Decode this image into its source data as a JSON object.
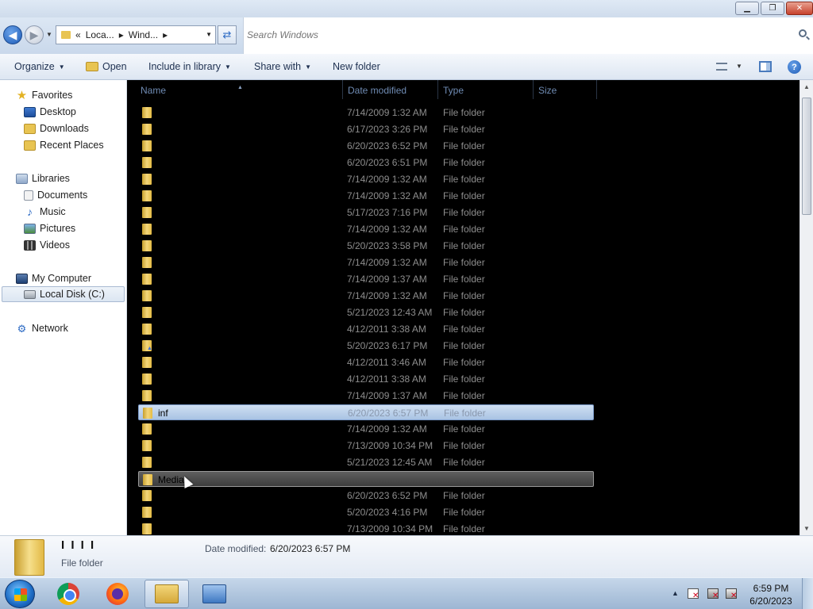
{
  "window": {
    "minimize_glyph": "▁",
    "maximize_glyph": "❐",
    "close_glyph": "✕"
  },
  "address_bar": {
    "prefix": "«",
    "crumbs": [
      "Loca...",
      "Wind..."
    ],
    "separator": "▸"
  },
  "search": {
    "placeholder": "Search Windows"
  },
  "toolbar": {
    "organize": "Organize",
    "open": "Open",
    "include_in_library": "Include in library",
    "share_with": "Share with",
    "new_folder": "New folder"
  },
  "nav": {
    "favorites": "Favorites",
    "desktop": "Desktop",
    "downloads": "Downloads",
    "recent_places": "Recent Places",
    "libraries": "Libraries",
    "documents": "Documents",
    "music": "Music",
    "pictures": "Pictures",
    "videos": "Videos",
    "my_computer": "My Computer",
    "local_disk": "Local Disk (C:)",
    "network": "Network"
  },
  "columns": {
    "name": "Name",
    "date_modified": "Date modified",
    "type": "Type",
    "size": "Size"
  },
  "files": [
    {
      "name": "",
      "date": "7/14/2009 1:32 AM",
      "type": "File folder"
    },
    {
      "name": "",
      "date": "6/17/2023 3:26 PM",
      "type": "File folder"
    },
    {
      "name": "",
      "date": "6/20/2023 6:52 PM",
      "type": "File folder"
    },
    {
      "name": "",
      "date": "6/20/2023 6:51 PM",
      "type": "File folder"
    },
    {
      "name": "",
      "date": "7/14/2009 1:32 AM",
      "type": "File folder"
    },
    {
      "name": "",
      "date": "7/14/2009 1:32 AM",
      "type": "File folder"
    },
    {
      "name": "",
      "date": "5/17/2023 7:16 PM",
      "type": "File folder"
    },
    {
      "name": "",
      "date": "7/14/2009 1:32 AM",
      "type": "File folder"
    },
    {
      "name": "",
      "date": "5/20/2023 3:58 PM",
      "type": "File folder"
    },
    {
      "name": "",
      "date": "7/14/2009 1:32 AM",
      "type": "File folder"
    },
    {
      "name": "",
      "date": "7/14/2009 1:37 AM",
      "type": "File folder"
    },
    {
      "name": "",
      "date": "7/14/2009 1:32 AM",
      "type": "File folder"
    },
    {
      "name": "",
      "date": "5/21/2023 12:43 AM",
      "type": "File folder"
    },
    {
      "name": "",
      "date": "4/12/2011 3:38 AM",
      "type": "File folder"
    },
    {
      "name": "",
      "date": "5/20/2023 6:17 PM",
      "type": "File folder"
    },
    {
      "name": "",
      "date": "4/12/2011 3:46 AM",
      "type": "File folder"
    },
    {
      "name": "",
      "date": "4/12/2011 3:38 AM",
      "type": "File folder"
    },
    {
      "name": "",
      "date": "7/14/2009 1:37 AM",
      "type": "File folder"
    },
    {
      "name": "inf",
      "date": "6/20/2023 6:57 PM",
      "type": "File folder"
    },
    {
      "name": "",
      "date": "7/14/2009 1:32 AM",
      "type": "File folder"
    },
    {
      "name": "",
      "date": "7/13/2009 10:34 PM",
      "type": "File folder"
    },
    {
      "name": "",
      "date": "5/21/2023 12:45 AM",
      "type": "File folder"
    },
    {
      "name": "Media",
      "date": "",
      "type": ""
    },
    {
      "name": "",
      "date": "6/20/2023 6:52 PM",
      "type": "File folder"
    },
    {
      "name": "",
      "date": "5/20/2023 4:16 PM",
      "type": "File folder"
    },
    {
      "name": "",
      "date": "7/13/2009 10:34 PM",
      "type": "File folder"
    }
  ],
  "details": {
    "name": "I I I I",
    "type": "File folder",
    "date_label": "Date modified:",
    "date_value": "6/20/2023 6:57 PM"
  },
  "clock": {
    "time": "6:59 PM",
    "date": "6/20/2023"
  }
}
